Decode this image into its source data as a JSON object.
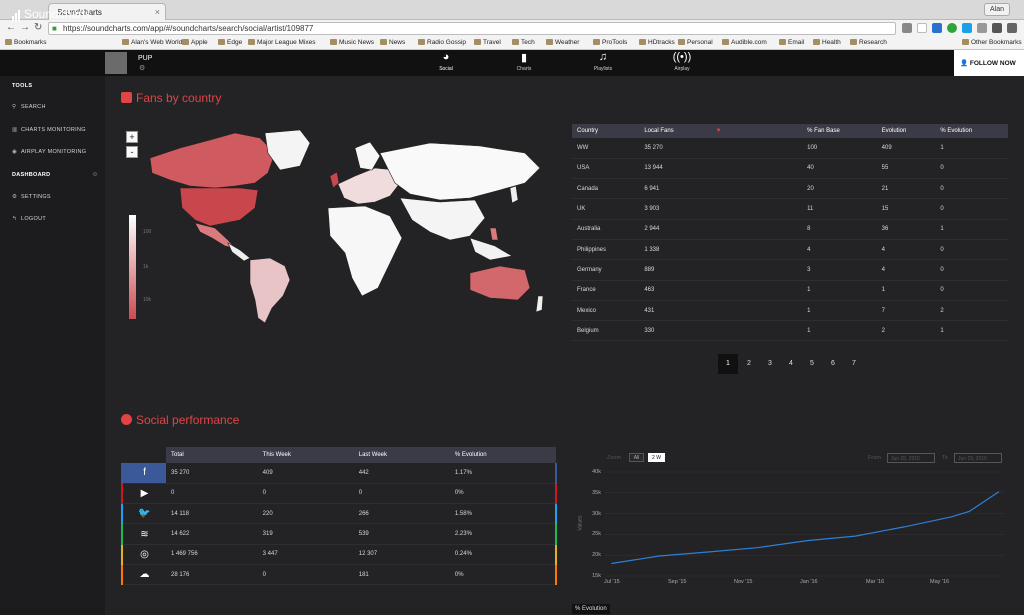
{
  "browser": {
    "tab_title": "Soundcharts",
    "tab_close": "×",
    "user": "Alan",
    "url": "https://soundcharts.com/app/#/soundcharts/search/social/artist/109877",
    "bookmarks": [
      "Bookmarks",
      "Alan's Web World",
      "Apple",
      "Edge",
      "Major League Mixes",
      "Music News",
      "News",
      "Radio Gossip",
      "Travel",
      "Tech",
      "Weather",
      "ProTools",
      "HDtracks",
      "Personal",
      "Audible.com",
      "Email",
      "Health",
      "Research",
      "Other Bookmarks"
    ]
  },
  "app": {
    "logo": "Soundcharts",
    "artist": "PUP",
    "nav": [
      {
        "label": "Social",
        "icon": "pie-icon"
      },
      {
        "label": "Charts",
        "icon": "bar-icon"
      },
      {
        "label": "Playlists",
        "icon": "music-note-icon"
      },
      {
        "label": "Airplay",
        "icon": "broadcast-icon"
      }
    ],
    "follow": "FOLLOW NOW"
  },
  "sidebar": {
    "tools": "TOOLS",
    "search": "SEARCH",
    "charts_monitoring": "CHARTS MONITORING",
    "airplay_monitoring": "AIRPLAY MONITORING",
    "dashboard": "DASHBOARD",
    "settings": "SETTINGS",
    "logout": "LOGOUT"
  },
  "fans_section": {
    "title": "Fans by country",
    "zoom_in": "+",
    "zoom_out": "-",
    "legend": [
      "10k",
      "1k",
      "100"
    ],
    "headers": [
      "Country",
      "Local Fans",
      "% Fan Base",
      "Evolution",
      "% Evolution"
    ],
    "rows": [
      [
        "WW",
        "35 270",
        "100",
        "409",
        "1"
      ],
      [
        "USA",
        "13 944",
        "40",
        "55",
        "0"
      ],
      [
        "Canada",
        "6 941",
        "20",
        "21",
        "0"
      ],
      [
        "UK",
        "3 903",
        "11",
        "15",
        "0"
      ],
      [
        "Australia",
        "2 944",
        "8",
        "36",
        "1"
      ],
      [
        "Philippines",
        "1 338",
        "4",
        "4",
        "0"
      ],
      [
        "Germany",
        "889",
        "3",
        "4",
        "0"
      ],
      [
        "France",
        "463",
        "1",
        "1",
        "0"
      ],
      [
        "Mexico",
        "431",
        "1",
        "7",
        "2"
      ],
      [
        "Belgium",
        "330",
        "1",
        "2",
        "1"
      ]
    ],
    "pages": [
      "1",
      "2",
      "3",
      "4",
      "5",
      "6",
      "7"
    ]
  },
  "social_section": {
    "title": "Social performance",
    "headers": [
      "Total",
      "This Week",
      "Last Week",
      "% Evolution"
    ],
    "rows": [
      {
        "icon": "facebook-icon",
        "glyph": "f",
        "color": "#3b5998",
        "values": [
          "35 270",
          "409",
          "442",
          "1.17%"
        ]
      },
      {
        "icon": "youtube-icon",
        "glyph": "▶",
        "color": "#cc181e",
        "values": [
          "0",
          "0",
          "0",
          "0%"
        ]
      },
      {
        "icon": "twitter-icon",
        "glyph": "🐦",
        "color": "#1da1f2",
        "values": [
          "14 118",
          "220",
          "266",
          "1.58%"
        ]
      },
      {
        "icon": "spotify-icon",
        "glyph": "≋",
        "color": "#1db954",
        "values": [
          "14 622",
          "319",
          "539",
          "2.23%"
        ]
      },
      {
        "icon": "instagram-icon",
        "glyph": "◎",
        "color": "#e6b020",
        "values": [
          "1 469 756",
          "3 447",
          "12 307",
          "0.24%"
        ]
      },
      {
        "icon": "soundcloud-icon",
        "glyph": "☁",
        "color": "#ff7700",
        "values": [
          "28 176",
          "0",
          "181",
          "0%"
        ]
      }
    ],
    "bottom_tag": "% Evolution"
  },
  "chart_controls": {
    "zoom_label": "Zoom",
    "zoom_options": [
      "All",
      "2 W"
    ],
    "from_label": "From",
    "from_value": "Jun 25, 2015",
    "to_label": "To",
    "to_value": "Jun 29, 2016"
  },
  "chart_data": {
    "type": "line",
    "ylabel": "Values",
    "y_ticks": [
      "40k",
      "35k",
      "30k",
      "25k",
      "20k",
      "15k"
    ],
    "x_ticks": [
      "Jul '15",
      "Sep '15",
      "Nov '15",
      "Jan '16",
      "Mar '16",
      "May '16"
    ],
    "ylim": [
      15000,
      40000
    ],
    "series": [
      {
        "x": [
          "2015-07-01",
          "2015-08-15",
          "2015-10-01",
          "2015-11-15",
          "2016-01-01",
          "2016-02-15",
          "2016-04-01",
          "2016-05-15",
          "2016-06-01",
          "2016-06-29"
        ],
        "values": [
          18000,
          19800,
          20800,
          21800,
          23500,
          24600,
          26800,
          29200,
          30500,
          35300
        ]
      }
    ],
    "color": "#2f7fd6"
  }
}
